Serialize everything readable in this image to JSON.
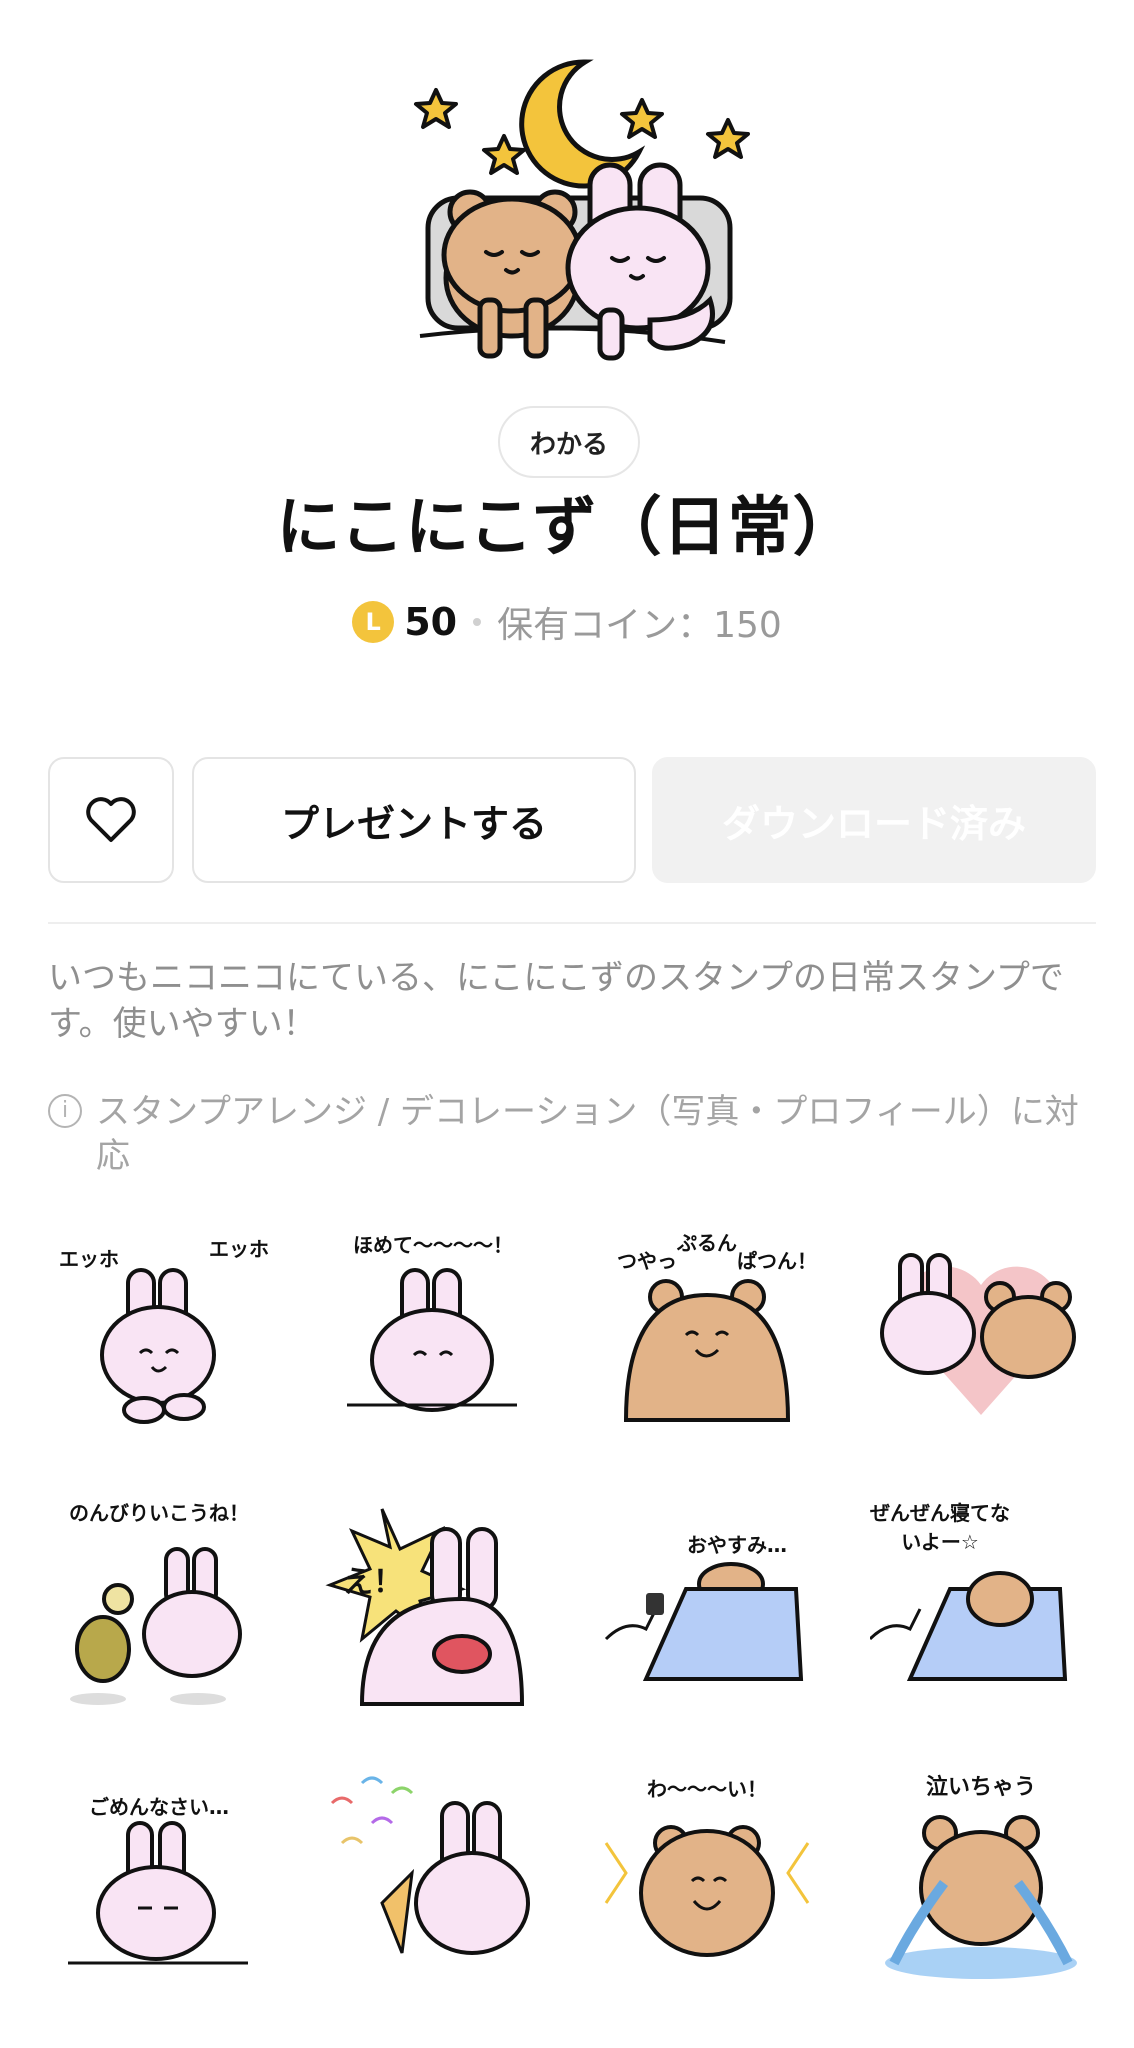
{
  "hero": {
    "image_name": "bear-and-rabbit-sleeping"
  },
  "tag": {
    "label": "わかる"
  },
  "title": "にこにこず（日常）",
  "price": {
    "coin_letter": "L",
    "amount": "50",
    "owned_text": "保有コイン：150"
  },
  "buttons": {
    "favorite": {
      "icon": "heart-icon"
    },
    "gift_label": "プレゼントする",
    "download_label": "ダウンロード済み"
  },
  "description": "いつもニコニコにている、にこにこずのスタンプの日常スタンプです。使いやすい！",
  "notice": "スタンプアレンジ / デコレーション（写真・プロフィール）に対応",
  "stickers": [
    {
      "caption_left": "エッホ",
      "caption_right": "エッホ"
    },
    {
      "caption": "ほめて〜〜〜〜！"
    },
    {
      "caption_left": "つやっ",
      "caption_mid": "ぷるん",
      "caption_right": "ぱつん！"
    },
    {
      "caption": ""
    },
    {
      "caption": "のんびりいこうね！"
    },
    {
      "caption": "え！"
    },
    {
      "caption": "おやすみ…"
    },
    {
      "caption": "ぜんぜん寝てないよー☆"
    },
    {
      "caption": "ごめんなさい…"
    },
    {
      "caption": ""
    },
    {
      "caption": "わ〜〜〜い！"
    },
    {
      "caption": "泣いちゃう"
    }
  ],
  "colors": {
    "rabbit": "#f9e4f4",
    "bear": "#e2b388",
    "coin": "#f3c43c"
  }
}
